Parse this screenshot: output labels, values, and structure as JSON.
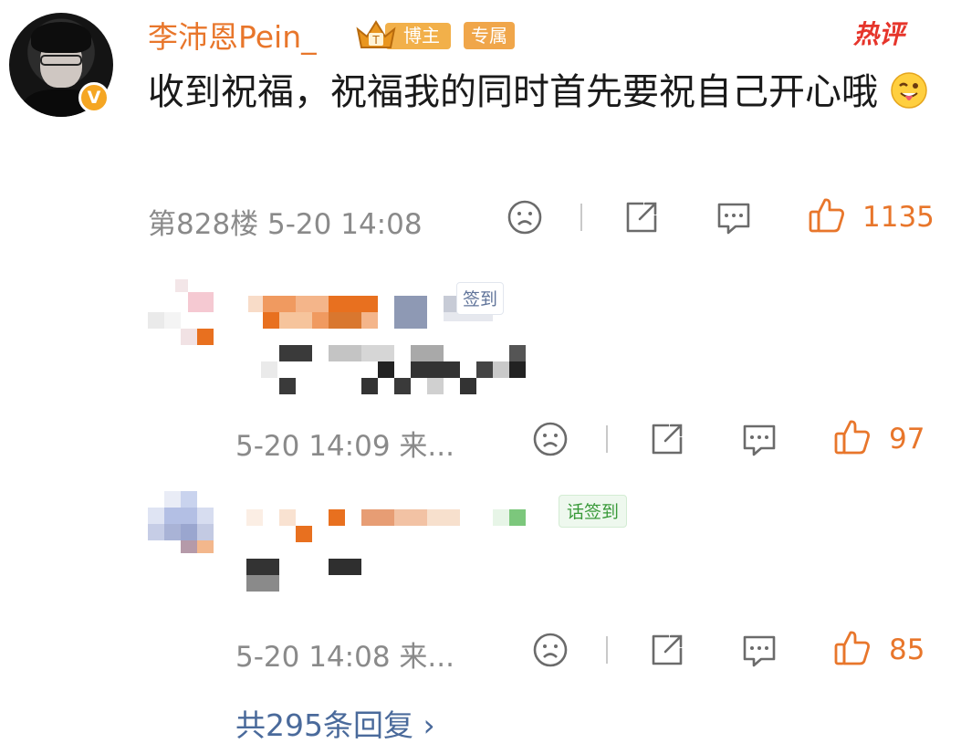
{
  "main_comment": {
    "username": "李沛恩Pein_",
    "badge_blogger": "博主",
    "badge_exclusive": "专属",
    "hot_label": "热评",
    "text": "收到祝福，祝福我的同时首先要祝自己开心哦",
    "floor_time": "第828楼 5-20 14:08",
    "like_count": "1135"
  },
  "replies": [
    {
      "tag_suffix": "签到",
      "time_source": "5-20 14:09 来...",
      "like_count": "97"
    },
    {
      "tag_suffix": "话签到",
      "time_source": "5-20 14:08 来...",
      "like_count": "85"
    }
  ],
  "more_replies": "共295条回复 ›",
  "colors": {
    "accent_orange": "#e8762b",
    "link_blue": "#4a6a9b",
    "hot_red": "#e6352b",
    "meta_gray": "#8a8a8a"
  },
  "icons": [
    "sad-face-icon",
    "share-icon",
    "comment-icon",
    "thumbs-up-icon",
    "chevron-right-icon",
    "verified-v-icon",
    "crown-icon"
  ]
}
